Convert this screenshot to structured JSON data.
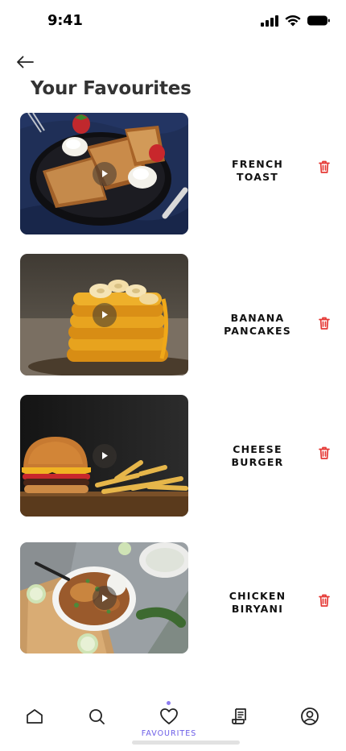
{
  "status_bar": {
    "time": "9:41"
  },
  "header": {
    "title": "Your Favourites"
  },
  "favourites": [
    {
      "name": "FRENCH TOAST"
    },
    {
      "name": "BANANA PANCAKES"
    },
    {
      "name": "CHEESE BURGER"
    },
    {
      "name": "CHICKEN BIRYANI"
    }
  ],
  "bottom_nav": {
    "items": [
      "home-icon",
      "search-icon",
      "heart-icon",
      "recipe-icon",
      "profile-icon"
    ],
    "active_label": "FAVOURITES"
  },
  "colors": {
    "accent": "#6b5ce7",
    "delete": "#e53935"
  }
}
